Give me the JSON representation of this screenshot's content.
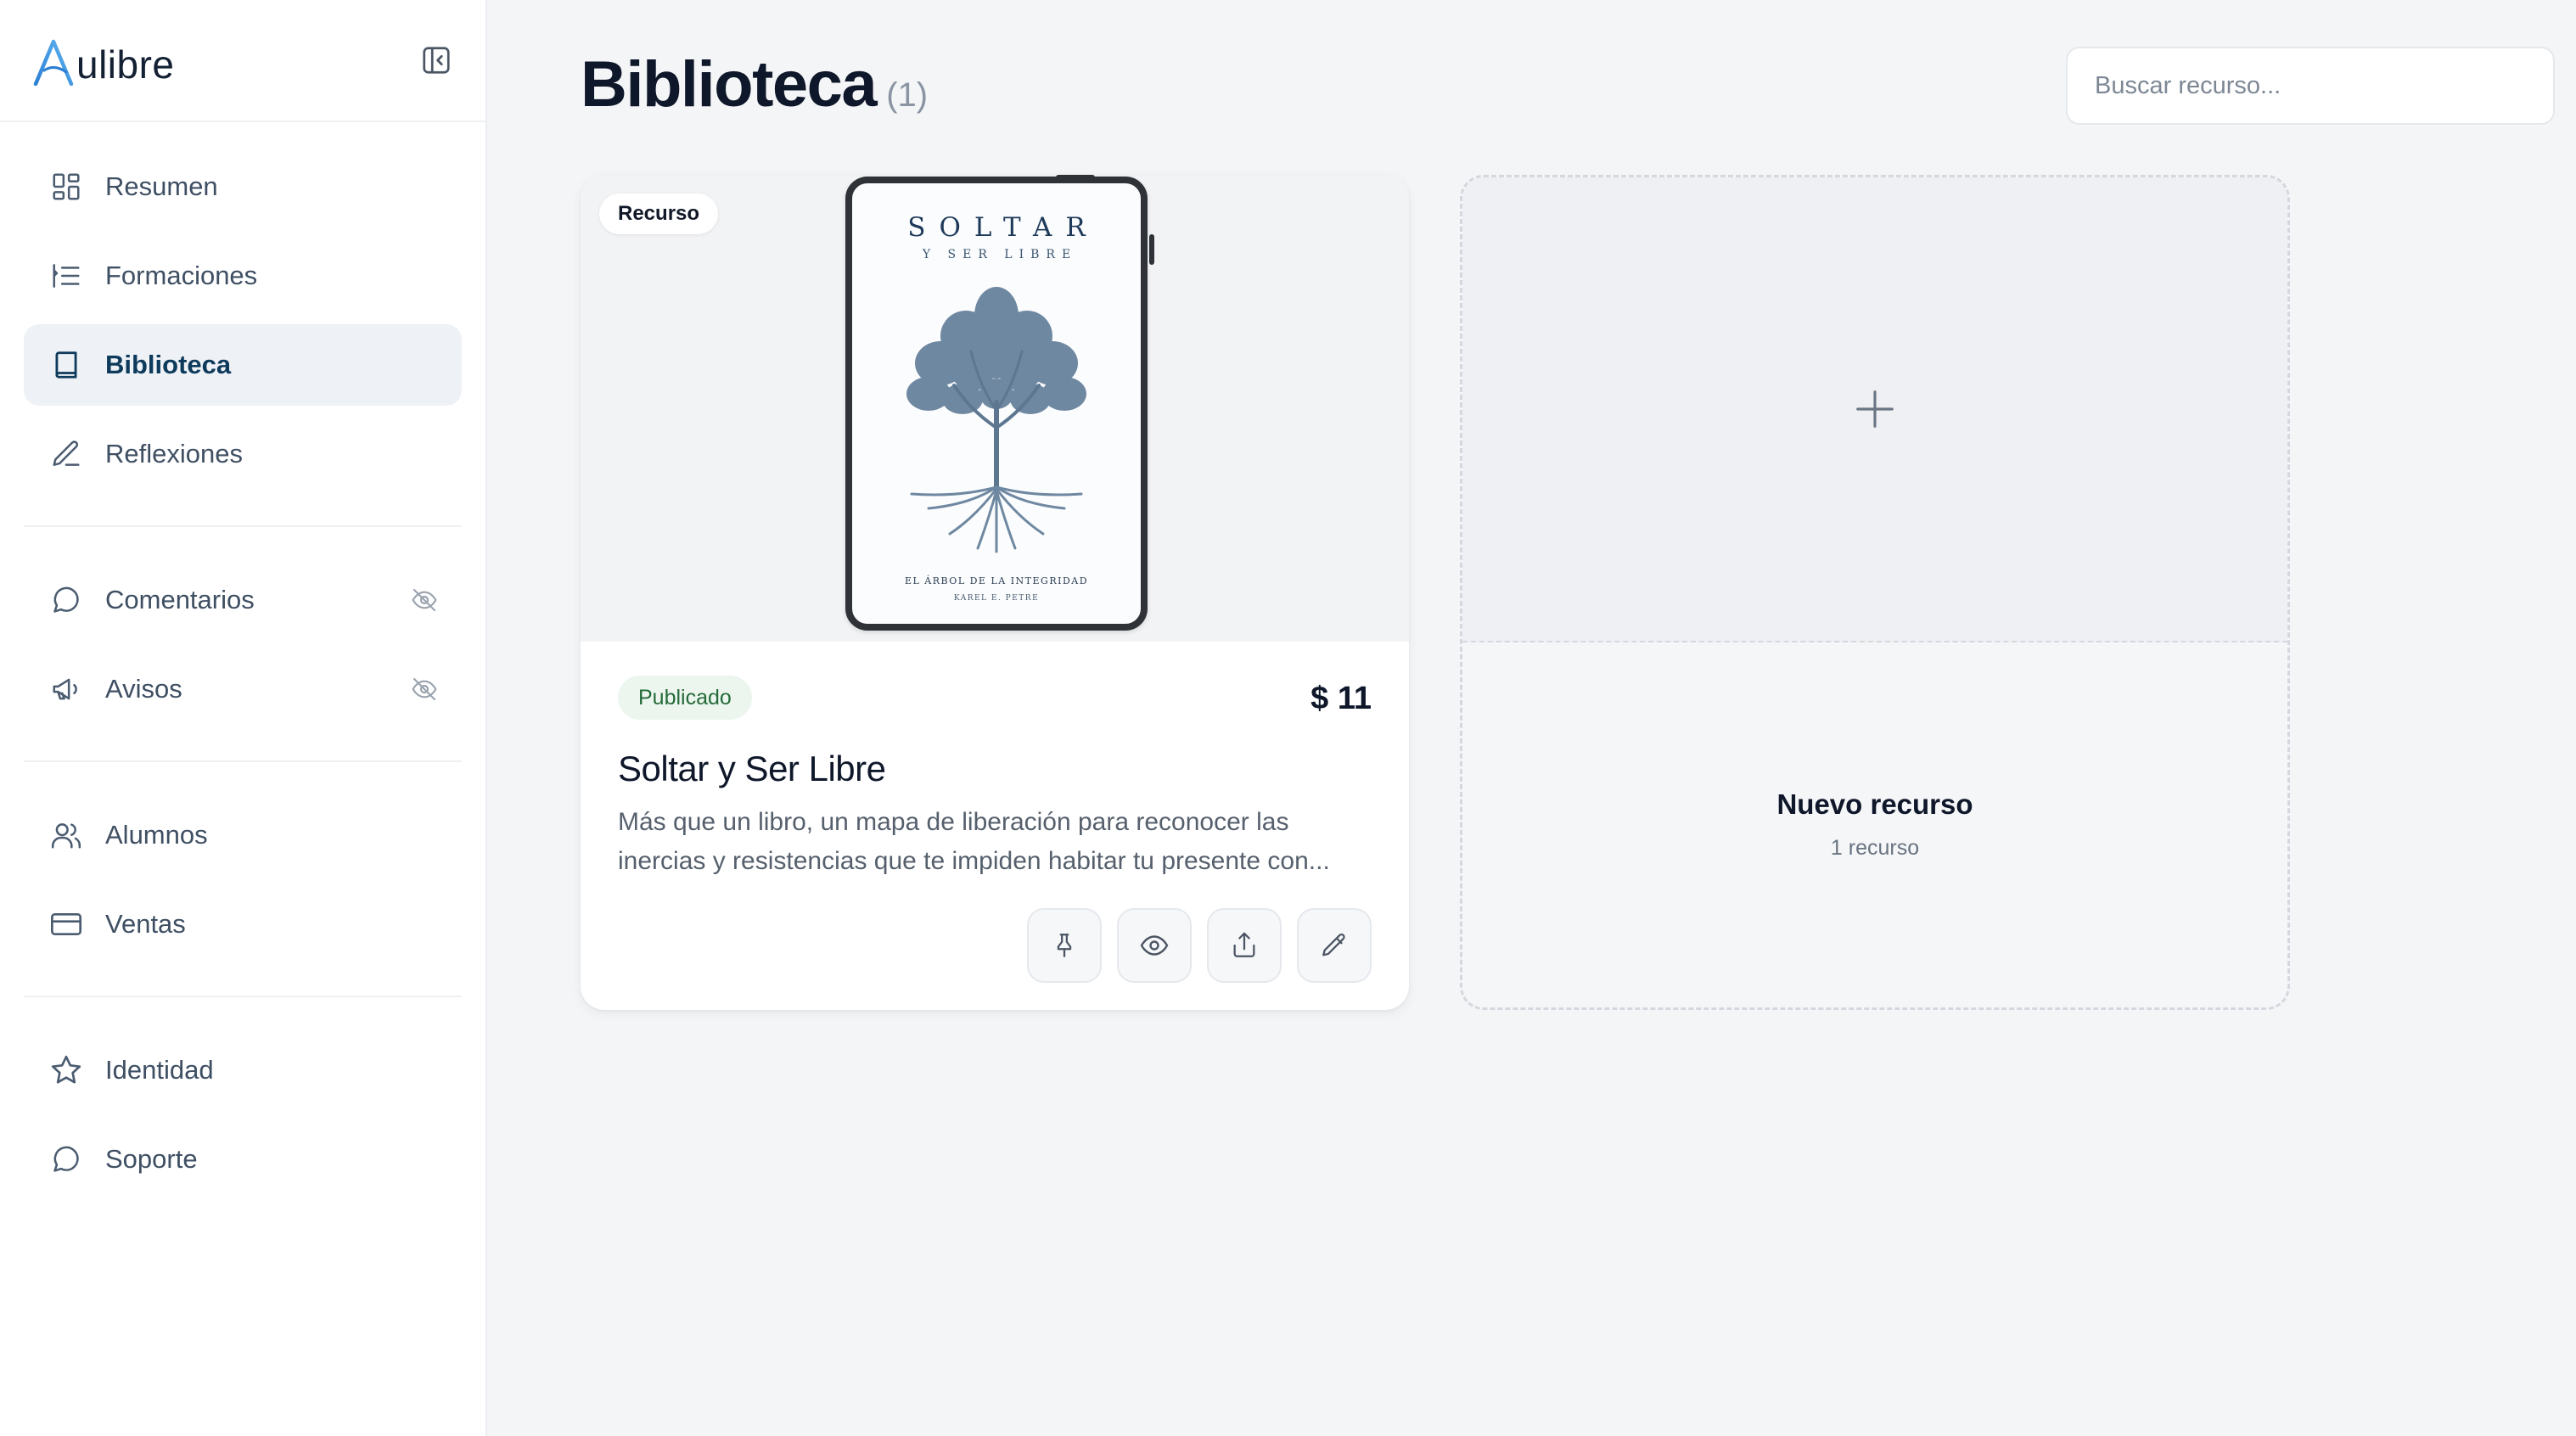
{
  "brand": {
    "name": "ulibre",
    "accent": "#2b7fd4"
  },
  "sidebar": {
    "groups": [
      {
        "items": [
          {
            "label": "Resumen",
            "icon": "dashboard-grid-icon"
          },
          {
            "label": "Formaciones",
            "icon": "list-indent-icon"
          },
          {
            "label": "Biblioteca",
            "icon": "book-icon",
            "active": true
          },
          {
            "label": "Reflexiones",
            "icon": "pen-icon"
          }
        ]
      },
      {
        "items": [
          {
            "label": "Comentarios",
            "icon": "message-circle-icon",
            "hidden": true
          },
          {
            "label": "Avisos",
            "icon": "megaphone-icon",
            "hidden": true
          }
        ]
      },
      {
        "items": [
          {
            "label": "Alumnos",
            "icon": "users-icon"
          },
          {
            "label": "Ventas",
            "icon": "credit-card-icon"
          }
        ]
      },
      {
        "items": [
          {
            "label": "Identidad",
            "icon": "star-icon"
          },
          {
            "label": "Soporte",
            "icon": "message-circle-icon"
          }
        ]
      }
    ]
  },
  "header": {
    "title": "Biblioteca",
    "count": "(1)",
    "search_placeholder": "Buscar recurso..."
  },
  "resources": [
    {
      "tag": "Recurso",
      "status": "Publicado",
      "price": "$ 11",
      "title": "Soltar y Ser Libre",
      "description": "Más que un libro, un mapa de liberación para reconocer las inercias y resistencias que te impiden habitar tu presente con...",
      "cover": {
        "title": "SOLTAR",
        "subtitle": "Y SER LIBRE",
        "footer": "EL ÁRBOL DE LA INTEGRIDAD",
        "author": "KAREL E. PETRE"
      },
      "actions": [
        "pin-icon",
        "eye-icon",
        "share-icon",
        "edit-pencil-icon"
      ]
    }
  ],
  "new_resource": {
    "title": "Nuevo recurso",
    "subtitle": "1 recurso"
  }
}
